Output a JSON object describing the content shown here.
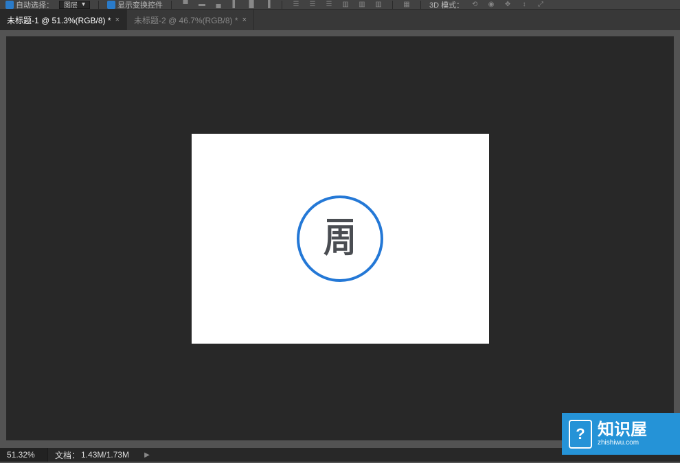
{
  "options": {
    "auto_select_label": "自动选择：",
    "layer_dropdown": "图层",
    "show_transform_label": "显示变换控件",
    "mode_3d_label": "3D 模式："
  },
  "tabs": [
    {
      "label": "未标题-1 @ 51.3%(RGB/8) *",
      "active": true
    },
    {
      "label": "未标题-2 @ 46.7%(RGB/8) *",
      "active": false
    }
  ],
  "canvas": {
    "logo_char": "周"
  },
  "status": {
    "zoom": "51.32%",
    "doc_label": "文档：",
    "doc_size": "1.43M/1.73M"
  },
  "watermark": {
    "title": "知识屋",
    "url": "zhishiwu.com",
    "icon_char": "?"
  }
}
